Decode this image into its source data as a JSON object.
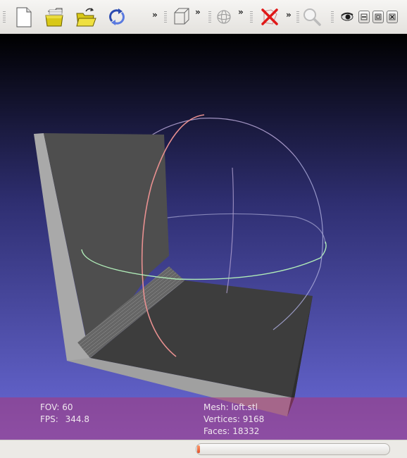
{
  "toolbar": {
    "buttons": [
      {
        "name": "new-document",
        "icon": "new-file-icon"
      },
      {
        "name": "import-mesh",
        "icon": "folder-stack-icon"
      },
      {
        "name": "open-project",
        "icon": "open-folder-icon"
      },
      {
        "name": "reload",
        "icon": "reload-arrows-icon"
      },
      {
        "name": "bounding-box",
        "icon": "wire-cube-icon"
      },
      {
        "name": "wire-sphere",
        "icon": "wire-sphere-icon"
      },
      {
        "name": "delete",
        "icon": "red-x-icon"
      },
      {
        "name": "search",
        "icon": "magnifier-icon"
      },
      {
        "name": "view",
        "icon": "eye-icon"
      }
    ],
    "overflow_label": "»",
    "window_controls": [
      "minimize",
      "restore",
      "close"
    ]
  },
  "info": {
    "fov_label": "FOV:",
    "fov_value": "60",
    "fps_label": "FPS:",
    "fps_value": "344.8",
    "mesh_label": "Mesh:",
    "mesh_value": "loft.stl",
    "vertices_label": "Vertices:",
    "vertices_value": "9168",
    "faces_label": "Faces:",
    "faces_value": "18332"
  },
  "status": {
    "progress_percent": 1.5
  },
  "colors": {
    "viewport_top": "#000000",
    "viewport_bottom": "#6a6ad8",
    "info_overlay": "#aa3778",
    "trackball_red": "#e08a8a",
    "trackball_green": "#a8e8b0",
    "trackball_blue": "#c0b8e0",
    "mesh_dark": "#4a4a4a",
    "mesh_light": "#a8a8a8"
  }
}
